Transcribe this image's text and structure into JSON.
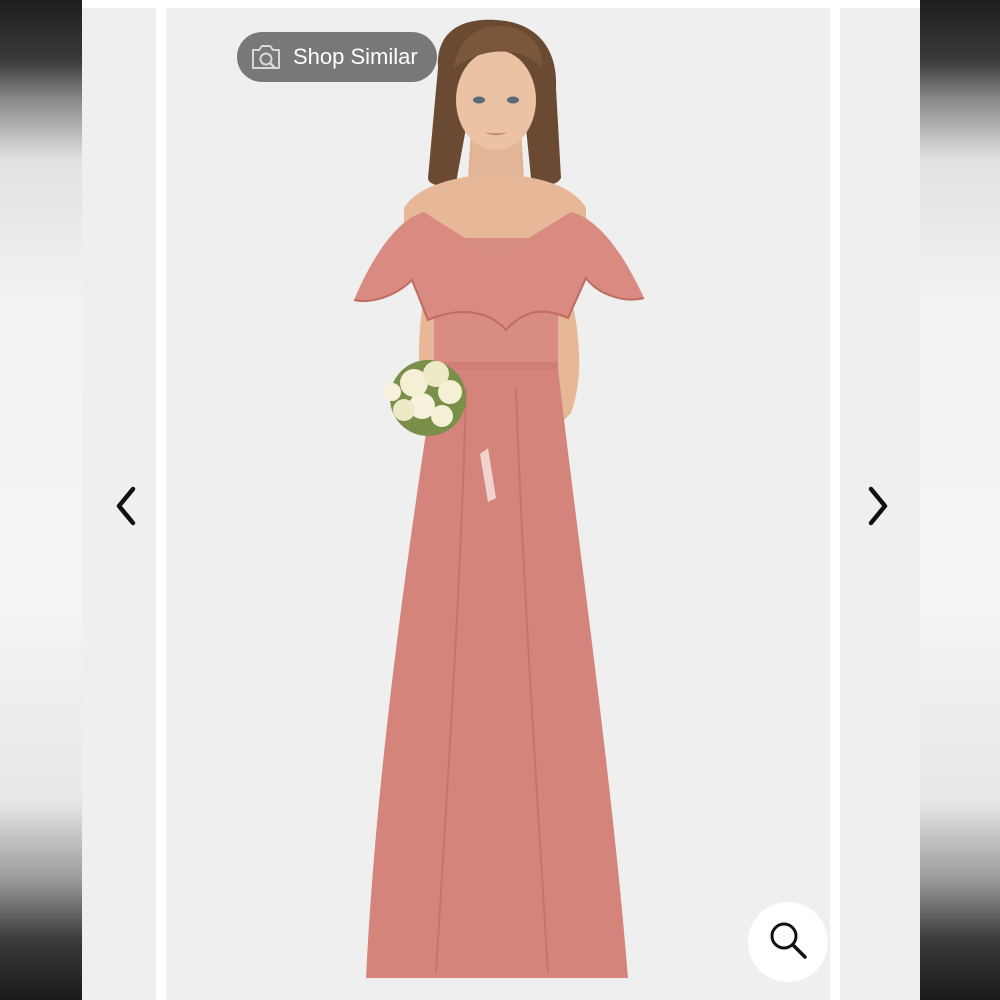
{
  "gallery": {
    "shop_similar": {
      "label": "Shop Similar",
      "icon": "camera-search-icon"
    },
    "prev_icon": "chevron-left-icon",
    "next_icon": "chevron-right-icon",
    "zoom_icon": "magnifier-icon"
  },
  "colors": {
    "background": "#efefef",
    "dress": "#d4847a",
    "pill": "#6e6e6e",
    "arrow": "#111111"
  }
}
